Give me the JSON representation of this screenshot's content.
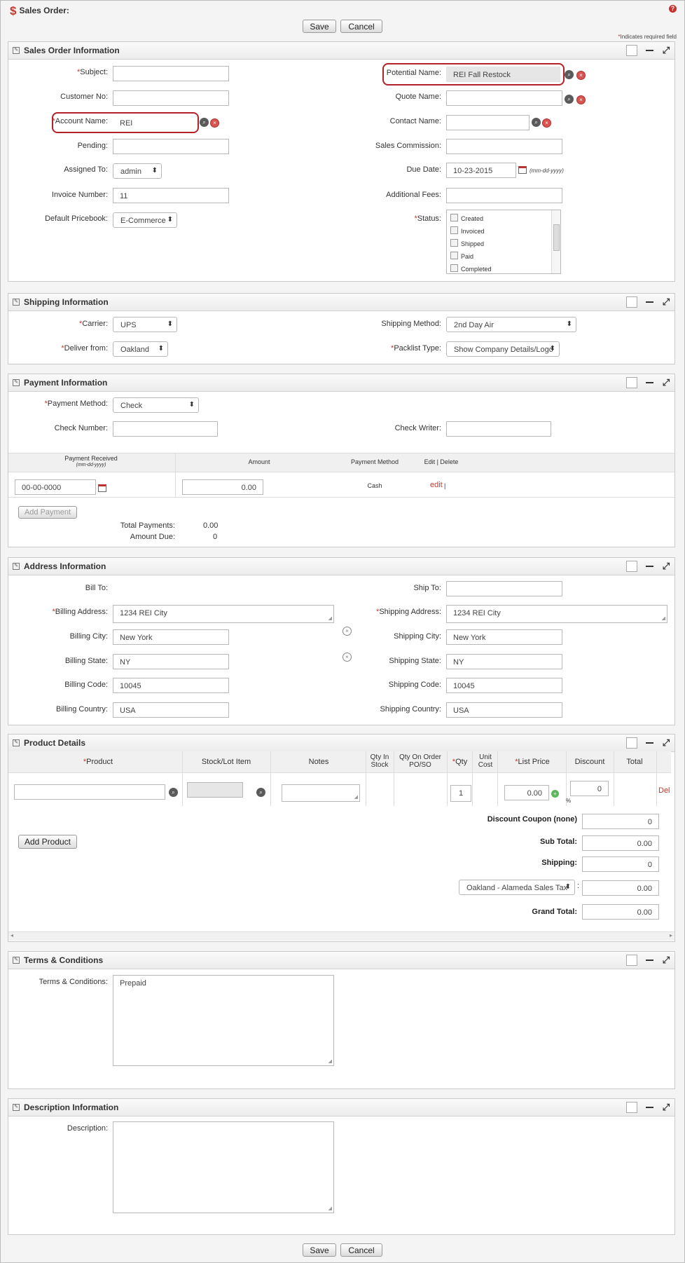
{
  "header": {
    "title": "Sales Order:",
    "save_label": "Save",
    "cancel_label": "Cancel",
    "required_note": "Indicates required field"
  },
  "sections": {
    "sales_order": "Sales Order Information",
    "shipping": "Shipping Information",
    "payment": "Payment Information",
    "address": "Address Information",
    "products": "Product Details",
    "terms": "Terms & Conditions",
    "description": "Description Information"
  },
  "so": {
    "subject_label": "Subject:",
    "subject_value": "",
    "customer_no_label": "Customer No:",
    "customer_no_value": "",
    "account_label": "Account Name:",
    "account_value": "REI",
    "pending_label": "Pending:",
    "pending_value": "",
    "assigned_label": "Assigned To:",
    "assigned_value": "admin",
    "invoice_label": "Invoice Number:",
    "invoice_value": "11",
    "pricebook_label": "Default Pricebook:",
    "pricebook_value": "E-Commerce",
    "potential_label": "Potential Name:",
    "potential_value": "REI Fall Restock",
    "quote_label": "Quote Name:",
    "quote_value": "",
    "contact_label": "Contact Name:",
    "contact_value": "",
    "commission_label": "Sales Commission:",
    "commission_value": "",
    "due_label": "Due Date:",
    "due_value": "10-23-2015",
    "due_format": "(mm-dd-yyyy)",
    "fees_label": "Additional Fees:",
    "fees_value": "",
    "status_label": "Status:",
    "status_options": [
      "Created",
      "Invoiced",
      "Shipped",
      "Paid",
      "Completed"
    ]
  },
  "ship": {
    "carrier_label": "Carrier:",
    "carrier_value": "UPS",
    "deliver_label": "Deliver from:",
    "deliver_value": "Oakland",
    "method_label": "Shipping Method:",
    "method_value": "2nd Day Air",
    "packlist_label": "Packlist Type:",
    "packlist_value": "Show Company Details/Logo"
  },
  "pay": {
    "method_label": "Payment Method:",
    "method_value": "Check",
    "check_no_label": "Check Number:",
    "check_no_value": "",
    "check_writer_label": "Check Writer:",
    "check_writer_value": "",
    "col_received": "Payment Received",
    "col_received_fmt": "(mm-dd-yyyy)",
    "col_amount": "Amount",
    "col_method": "Payment Method",
    "col_edit": "Edit | Delete",
    "row_date": "00-00-0000",
    "row_amount": "0.00",
    "row_method": "Cash",
    "row_edit": "edit",
    "row_sep": "|",
    "add_payment": "Add Payment",
    "total_label": "Total Payments:",
    "total_value": "0.00",
    "due_label": "Amount Due:",
    "due_value": "0"
  },
  "addr": {
    "bill_to_label": "Bill To:",
    "ship_to_label": "Ship To:",
    "ship_to_value": "",
    "bill_addr_label": "Billing Address:",
    "bill_addr_value": "1234 REI City",
    "ship_addr_label": "Shipping Address:",
    "ship_addr_value": "1234 REI City",
    "bill_city_label": "Billing City:",
    "bill_city_value": "New York",
    "ship_city_label": "Shipping City:",
    "ship_city_value": "New York",
    "bill_state_label": "Billing State:",
    "bill_state_value": "NY",
    "ship_state_label": "Shipping State:",
    "ship_state_value": "NY",
    "bill_code_label": "Billing Code:",
    "bill_code_value": "10045",
    "ship_code_label": "Shipping Code:",
    "ship_code_value": "10045",
    "bill_country_label": "Billing Country:",
    "bill_country_value": "USA",
    "ship_country_label": "Shipping Country:",
    "ship_country_value": "USA"
  },
  "prod": {
    "columns": [
      "Product",
      "Stock/Lot Item",
      "Notes",
      "Qty In Stock",
      "Qty On Order PO/SO",
      "Qty",
      "Unit Cost",
      "List Price",
      "Discount",
      "Total"
    ],
    "qty_value": "1",
    "list_price_value": "0.00",
    "discount_value": "0",
    "pct": "%",
    "del_label": "Del",
    "add_product": "Add Product",
    "coupon_label": "Discount Coupon (none)",
    "coupon_value": "0",
    "subtotal_label": "Sub Total:",
    "subtotal_value": "0.00",
    "shipping_label": "Shipping:",
    "shipping_value": "0",
    "tax_value": "Oakland - Alameda Sales Tax",
    "tax_amount": "0.00",
    "grand_label": "Grand Total:",
    "grand_value": "0.00"
  },
  "terms": {
    "label": "Terms & Conditions:",
    "value": "Prepaid"
  },
  "desc": {
    "label": "Description:",
    "value": ""
  }
}
